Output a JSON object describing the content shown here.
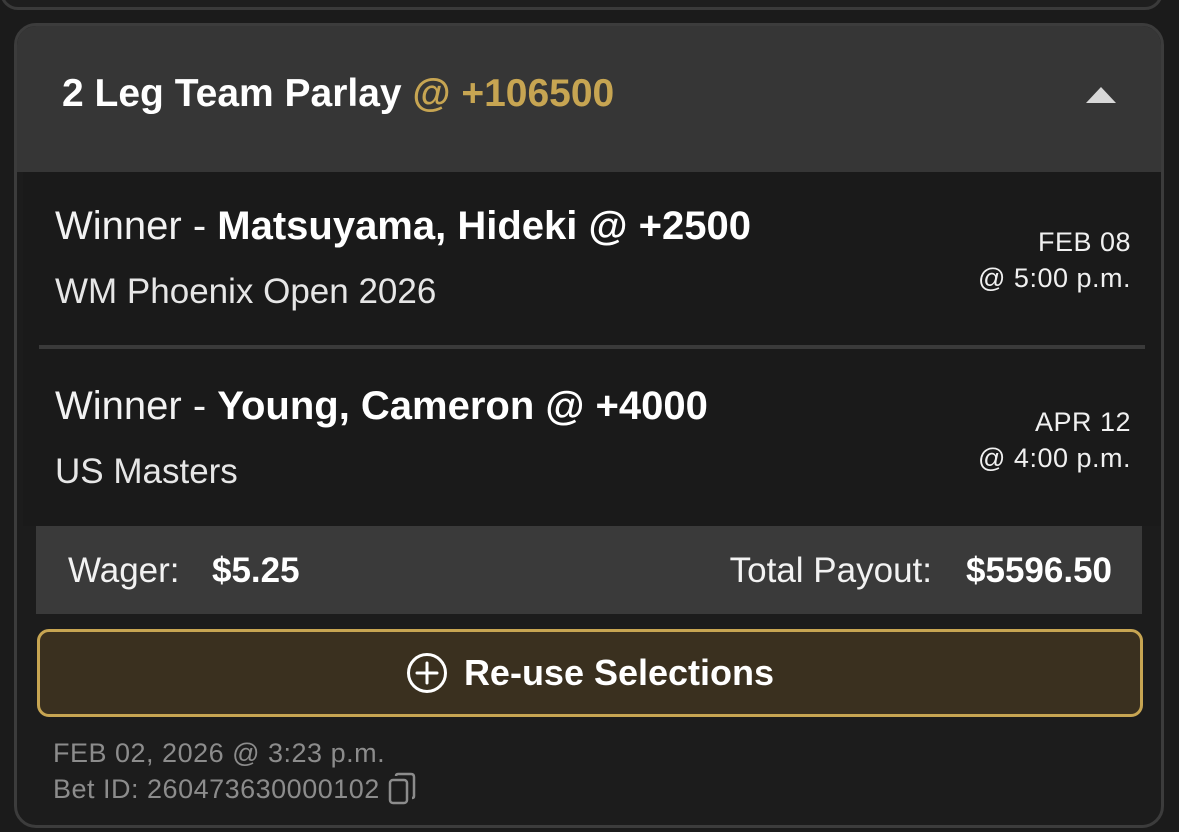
{
  "bet": {
    "title": "2 Leg Team Parlay",
    "odds": "@ +106500",
    "legs": [
      {
        "market": "Winner - ",
        "pick": "Matsuyama, Hideki @ +2500",
        "event": "WM Phoenix Open 2026",
        "date": "FEB 08",
        "time": "@ 5:00 p.m."
      },
      {
        "market": "Winner - ",
        "pick": "Young, Cameron @ +4000",
        "event": "US Masters",
        "date": "APR 12",
        "time": "@ 4:00 p.m."
      }
    ],
    "wager_label": "Wager:",
    "wager_value": "$5.25",
    "payout_label": "Total Payout:",
    "payout_value": "$5596.50",
    "reuse_label": "Re-use Selections",
    "placed_date": "FEB 02, 2026 @ 3:23 p.m.",
    "bet_id": "Bet ID: 260473630000102"
  },
  "icons": {
    "collapse": "chevron-up-icon",
    "reuse": "plus-circle-icon",
    "copy": "copy-icon"
  },
  "colors": {
    "accent_gold": "#c7a552",
    "button_bg": "#3a301f",
    "header_bg": "#363636",
    "card_bg": "#1c1c1c"
  }
}
